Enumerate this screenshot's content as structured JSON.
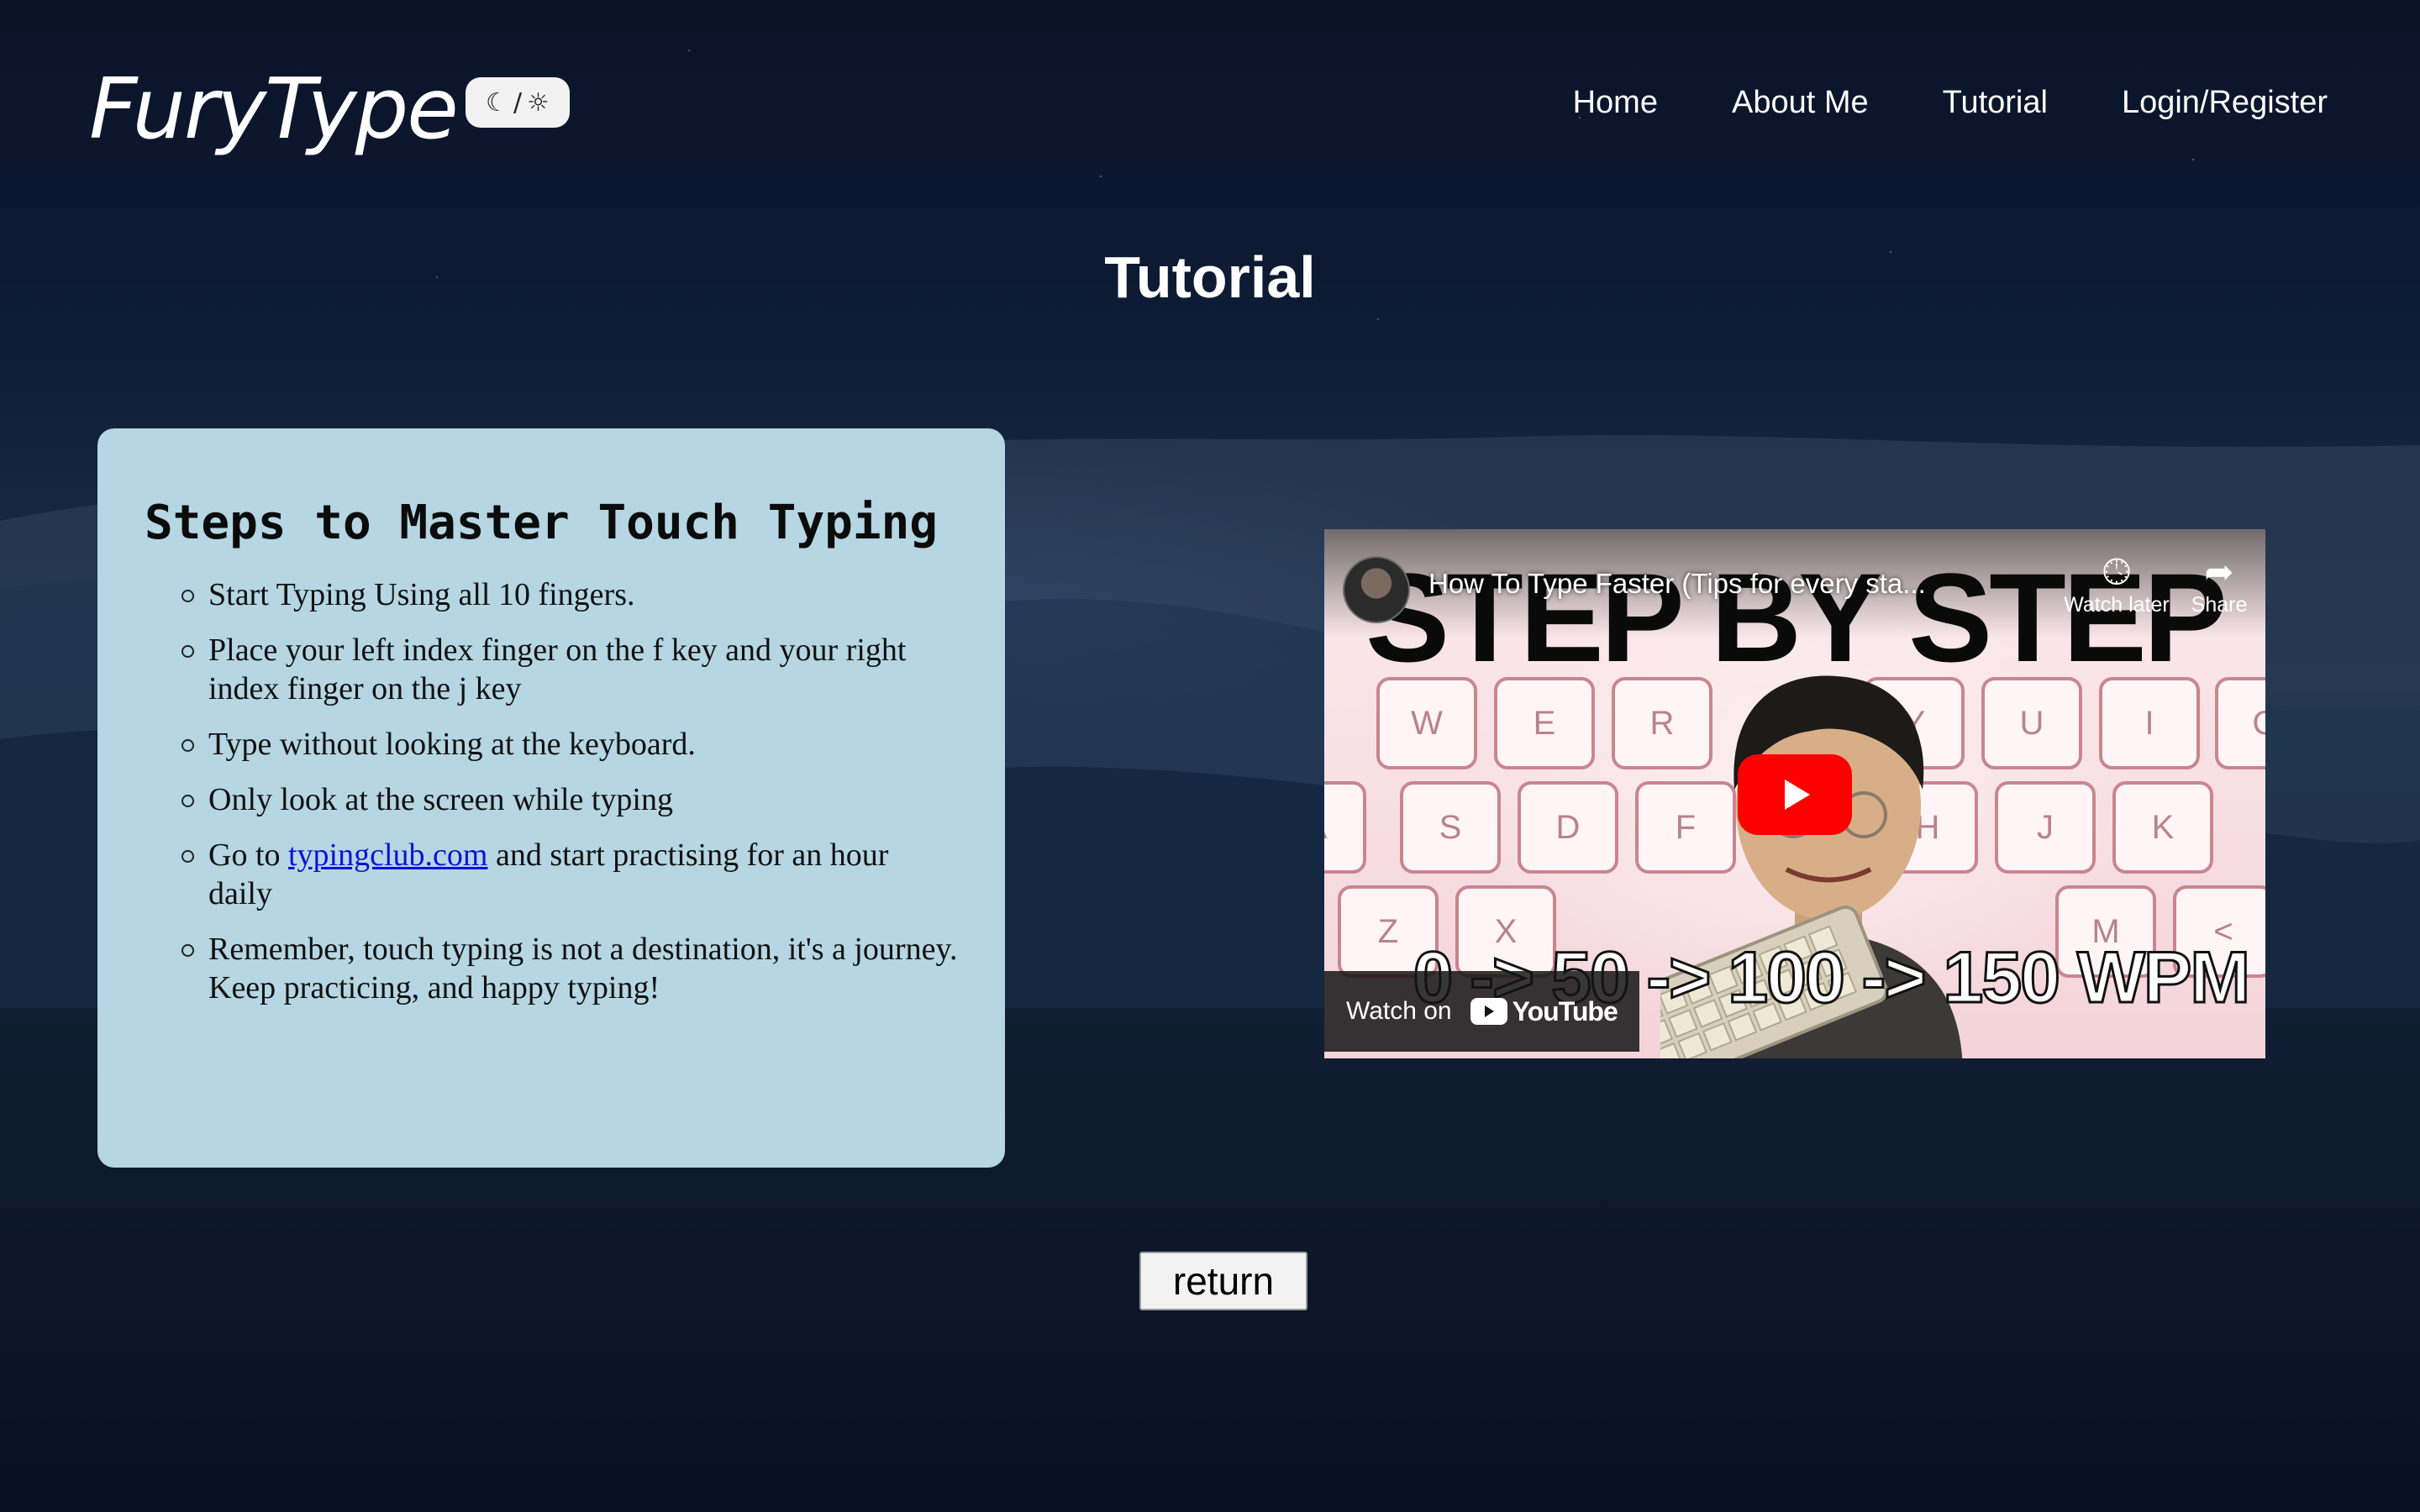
{
  "header": {
    "logo": "FuryType",
    "theme_toggle": {
      "moon": "☾",
      "separator": "/",
      "sun": "☼"
    },
    "nav": [
      "Home",
      "About Me",
      "Tutorial",
      "Login/Register"
    ]
  },
  "page": {
    "title": "Tutorial"
  },
  "card": {
    "heading": "Steps to Master Touch Typing",
    "steps": [
      "Start Typing Using all 10 fingers.",
      "Place your left index finger on the f key and your right index finger on the j key",
      "Type without looking at the keyboard.",
      "Only look at the screen while typing",
      {
        "before": "Go to ",
        "link": "typingclub.com",
        "after": " and start practising for an hour daily"
      },
      "Remember, touch typing is not a destination, it's a journey. Keep practicing, and happy typing!"
    ]
  },
  "video": {
    "title": "How To Type Faster (Tips for every sta...",
    "watch_later": "Watch later",
    "share": "Share",
    "thumbnail_text_top": "STEP BY STEP",
    "thumbnail_text_bottom": "0 -> 50 -> 100 -> 150 WPM",
    "watch_on": "Watch on",
    "youtube": "YouTube",
    "keys": [
      "W",
      "E",
      "R",
      "Y",
      "U",
      "I",
      "O",
      "A",
      "S",
      "D",
      "F",
      "H",
      "J",
      "K",
      "Z",
      "X",
      "M",
      "<"
    ],
    "colors": {
      "play": "#ff0000",
      "key_border": "#c98590"
    }
  },
  "return_button": "return",
  "colors": {
    "card_bg": "#b5d6e2",
    "link": "#0b14d6"
  }
}
